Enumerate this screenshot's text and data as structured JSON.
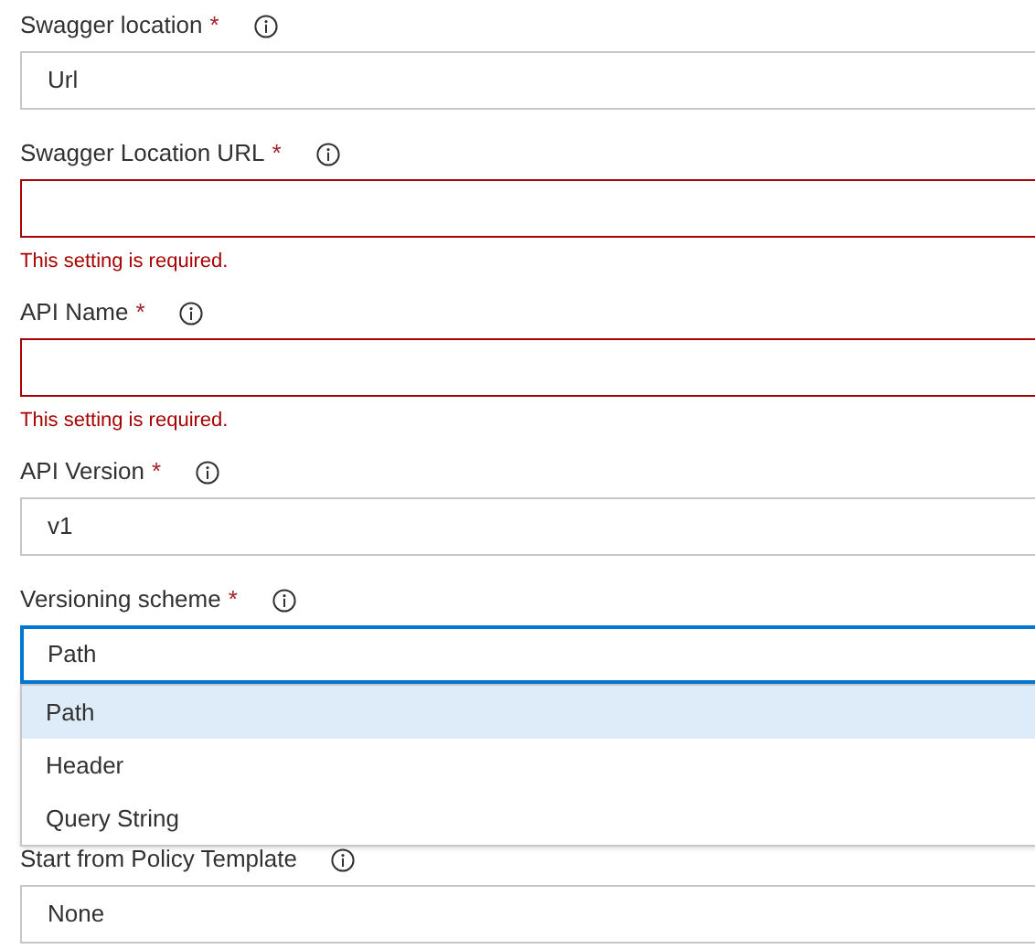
{
  "fields": [
    {
      "kind": "select",
      "label": "Swagger location",
      "required_mark": "*",
      "value": "Url",
      "invalid": false,
      "focused": false
    },
    {
      "kind": "text",
      "label": "Swagger Location URL",
      "required_mark": "*",
      "invalid": true,
      "focused": false,
      "error": "This setting is required."
    },
    {
      "kind": "text",
      "label": "API Name",
      "required_mark": "*",
      "invalid": true,
      "focused": false,
      "error": "This setting is required."
    },
    {
      "kind": "text",
      "label": "API Version",
      "required_mark": "*",
      "value": "v1",
      "invalid": false,
      "focused": false
    },
    {
      "kind": "select",
      "label": "Versioning scheme",
      "required_mark": "*",
      "value": "Path",
      "invalid": false,
      "focused": true,
      "expanded": true,
      "options": [
        {
          "label": "Path",
          "selected": true
        },
        {
          "label": "Header",
          "selected": false
        },
        {
          "label": "Query String",
          "selected": false
        }
      ]
    },
    {
      "kind": "select",
      "label": "Start from Policy Template",
      "value": "None",
      "invalid": false,
      "focused": false
    }
  ]
}
